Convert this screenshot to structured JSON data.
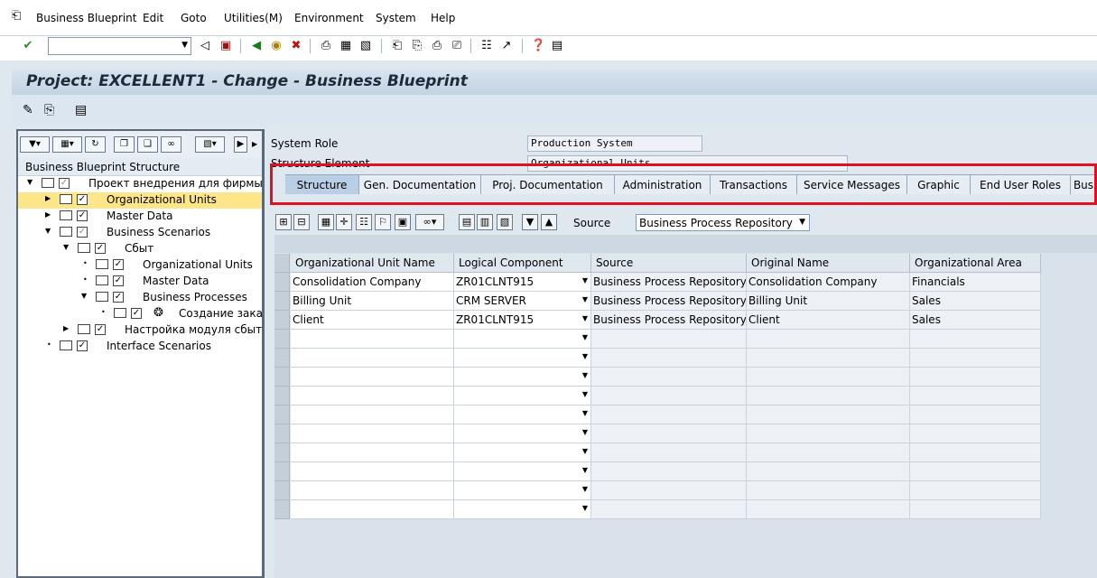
{
  "menu": {
    "items": [
      "Business Blueprint",
      "Edit",
      "Goto",
      "Utilities(M)",
      "Environment",
      "System",
      "Help"
    ]
  },
  "toolbar": {
    "command_field": ""
  },
  "title": "Project: EXCELLENT1 - Change - Business Blueprint",
  "tree": {
    "header": "Business Blueprint Structure",
    "nodes": [
      {
        "label": "Проект внедрения для фирмы \"E"
      },
      {
        "label": "Organizational Units"
      },
      {
        "label": "Master Data"
      },
      {
        "label": "Business Scenarios"
      },
      {
        "label": "Сбыт"
      },
      {
        "label": "Organizational Units"
      },
      {
        "label": "Master Data"
      },
      {
        "label": "Business Processes"
      },
      {
        "label": "Создание заказа"
      },
      {
        "label": "Настройка модуля сбыт"
      },
      {
        "label": "Interface Scenarios"
      }
    ]
  },
  "fields": {
    "system_role_label": "System Role",
    "system_role_value": "Production System",
    "structure_element_label": "Structure Element",
    "structure_element_value": "Organizational Units"
  },
  "tabs": [
    "Structure",
    "Gen. Documentation",
    "Proj. Documentation",
    "Administration",
    "Transactions",
    "Service Messages",
    "Graphic",
    "End User Roles",
    "Bus"
  ],
  "source": {
    "label": "Source",
    "value": "Business Process Repository"
  },
  "grid": {
    "columns": [
      "Organizational Unit Name",
      "Logical Component",
      "Source",
      "Original Name",
      "Organizational Area"
    ],
    "rows": [
      [
        "Consolidation Company",
        "ZR01CLNT915",
        "Business Process Repository",
        "Consolidation Company",
        "Financials"
      ],
      [
        "Billing Unit",
        "CRM SERVER",
        "Business Process Repository",
        "Billing Unit",
        "Sales"
      ],
      [
        "Client",
        "ZR01CLNT915",
        "Business Process Repository",
        "Client",
        "Sales"
      ]
    ]
  },
  "colors": {
    "highlight_box": "#e01020",
    "selected_node": "#fde68a",
    "title_text": "#1c2a3a"
  }
}
